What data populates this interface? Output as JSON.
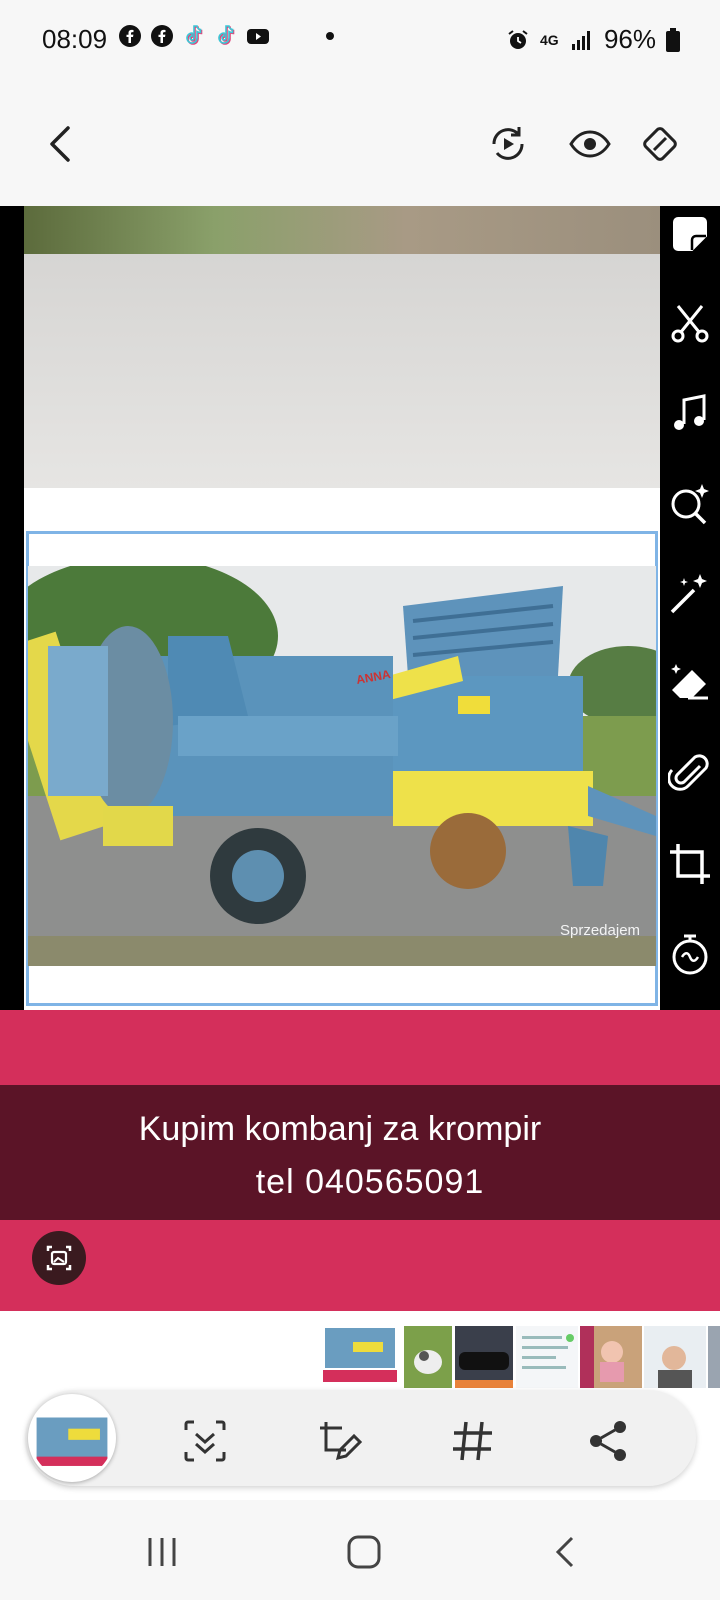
{
  "status_bar": {
    "time": "08:09",
    "battery": "96%",
    "network": "4G",
    "icons_left": [
      "facebook-icon",
      "facebook-icon",
      "tiktok-icon",
      "tiktok-icon",
      "youtube-icon",
      "dot-icon"
    ],
    "icons_right": [
      "alarm-icon",
      "network-4g-icon",
      "signal-icon",
      "battery-icon"
    ]
  },
  "top_bar": {
    "icons": [
      "back-icon",
      "remaster-icon",
      "view-icon",
      "auto-rotate-icon"
    ]
  },
  "photo": {
    "watermark": "Sprzedajem",
    "badge_text": "ANNA"
  },
  "annotation": {
    "line1": "Kupim kombanj za krompir",
    "line2": "tel  040565091"
  },
  "side_tools": [
    "sticker-icon",
    "cut-icon",
    "music-icon",
    "magnify-sparkle-icon",
    "magic-wand-icon",
    "eraser-icon",
    "paperclip-icon",
    "crop-icon",
    "timer-icon"
  ],
  "bottom_bar": {
    "icons": [
      "select-icon",
      "edit-icon",
      "hashtag-icon",
      "share-icon"
    ]
  },
  "thumbnails": [
    "machine-photo",
    "puppy-photo",
    "car-photo",
    "screenshot-photo",
    "child-photo",
    "people-photo"
  ],
  "nav": [
    "recents-icon",
    "home-icon",
    "back-nav-icon"
  ],
  "colors": {
    "annotation_red": "#d42f5b",
    "annotation_dark": "#5b1427",
    "frame_blue": "#7fb4e6",
    "machine_blue": "#4f8fb8",
    "machine_yellow": "#eedc3c"
  }
}
